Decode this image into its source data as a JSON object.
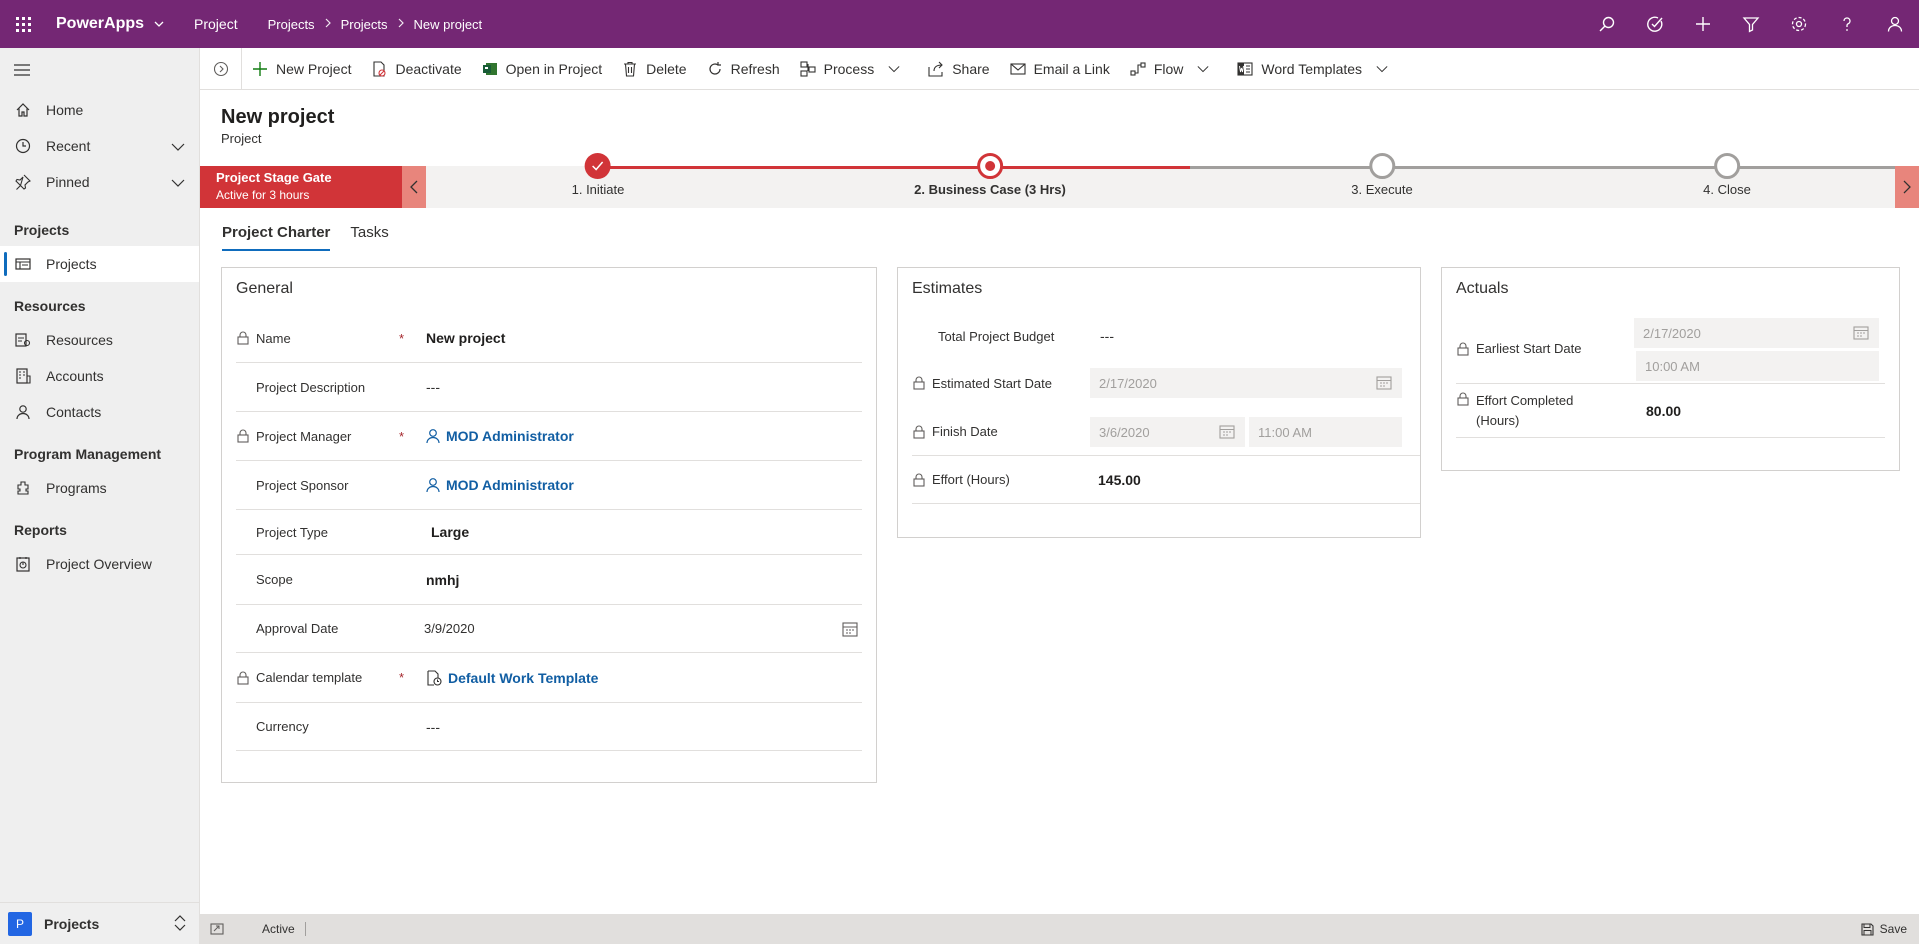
{
  "topbar": {
    "brand": "PowerApps",
    "app": "Project",
    "breadcrumbs": [
      "Projects",
      "Projects",
      "New project"
    ],
    "icons": [
      "search-icon",
      "task-icon",
      "plus-icon",
      "filter-icon",
      "gear-icon",
      "help-icon",
      "user-icon"
    ]
  },
  "sidebar": {
    "top_items": [
      {
        "label": "Home",
        "icon": "home-icon"
      },
      {
        "label": "Recent",
        "icon": "clock-icon"
      },
      {
        "label": "Pinned",
        "icon": "pin-icon"
      }
    ],
    "groups": [
      {
        "title": "Projects",
        "items": [
          {
            "label": "Projects",
            "icon": "projects-icon",
            "active": true
          }
        ]
      },
      {
        "title": "Resources",
        "items": [
          {
            "label": "Resources",
            "icon": "resources-icon"
          },
          {
            "label": "Accounts",
            "icon": "accounts-icon"
          },
          {
            "label": "Contacts",
            "icon": "contact-icon"
          }
        ]
      },
      {
        "title": "Program Management",
        "items": [
          {
            "label": "Programs",
            "icon": "programs-icon"
          }
        ]
      },
      {
        "title": "Reports",
        "items": [
          {
            "label": "Project Overview",
            "icon": "report-icon"
          }
        ]
      }
    ],
    "area": {
      "badge": "P",
      "label": "Projects"
    }
  },
  "commands": [
    {
      "label": "New Project",
      "icon": "plus-icon"
    },
    {
      "label": "Deactivate",
      "icon": "deactivate-icon"
    },
    {
      "label": "Open in Project",
      "icon": "project-icon"
    },
    {
      "label": "Delete",
      "icon": "trash-icon"
    },
    {
      "label": "Refresh",
      "icon": "refresh-icon"
    },
    {
      "label": "Process",
      "icon": "process-icon",
      "dropdown": true
    },
    {
      "label": "Share",
      "icon": "share-icon"
    },
    {
      "label": "Email a Link",
      "icon": "mail-icon"
    },
    {
      "label": "Flow",
      "icon": "flow-icon",
      "dropdown": true
    },
    {
      "label": "Word Templates",
      "icon": "word-icon",
      "dropdown": true
    }
  ],
  "header": {
    "title": "New project",
    "entity": "Project"
  },
  "bpf": {
    "name": "Project Stage Gate",
    "active_for": "Active for 3 hours",
    "stages": [
      "1. Initiate",
      "2. Business Case  (3 Hrs)",
      "3. Execute",
      "4. Close"
    ],
    "current_stage": 1,
    "accent": "#d13438"
  },
  "tabs": [
    "Project Charter",
    "Tasks"
  ],
  "general": {
    "title": "General",
    "name_label": "Name",
    "name_value": "New project",
    "desc_label": "Project Description",
    "desc_value": "---",
    "pm_label": "Project Manager",
    "pm_value": "MOD Administrator",
    "sponsor_label": "Project Sponsor",
    "sponsor_value": "MOD Administrator",
    "type_label": "Project Type",
    "type_value": "Large",
    "scope_label": "Scope",
    "scope_value": "nmhj",
    "approval_label": "Approval Date",
    "approval_value": "3/9/2020",
    "calendar_label": "Calendar template",
    "calendar_value": "Default Work Template",
    "currency_label": "Currency",
    "currency_value": "---",
    "required_mark": "*"
  },
  "estimates": {
    "title": "Estimates",
    "budget_label": "Total Project Budget",
    "budget_value": "---",
    "start_label": "Estimated Start Date",
    "start_value": "2/17/2020",
    "finish_label": "Finish Date",
    "finish_date": "3/6/2020",
    "finish_time": "11:00 AM",
    "effort_label": "Effort (Hours)",
    "effort_value": "145.00"
  },
  "actuals": {
    "title": "Actuals",
    "earliest_label": "Earliest Start Date",
    "earliest_date": "2/17/2020",
    "earliest_time": "10:00 AM",
    "completed_label_1": "Effort Completed",
    "completed_label_2": "(Hours)",
    "completed_value": "80.00"
  },
  "statusbar": {
    "status": "Active",
    "save": "Save"
  }
}
